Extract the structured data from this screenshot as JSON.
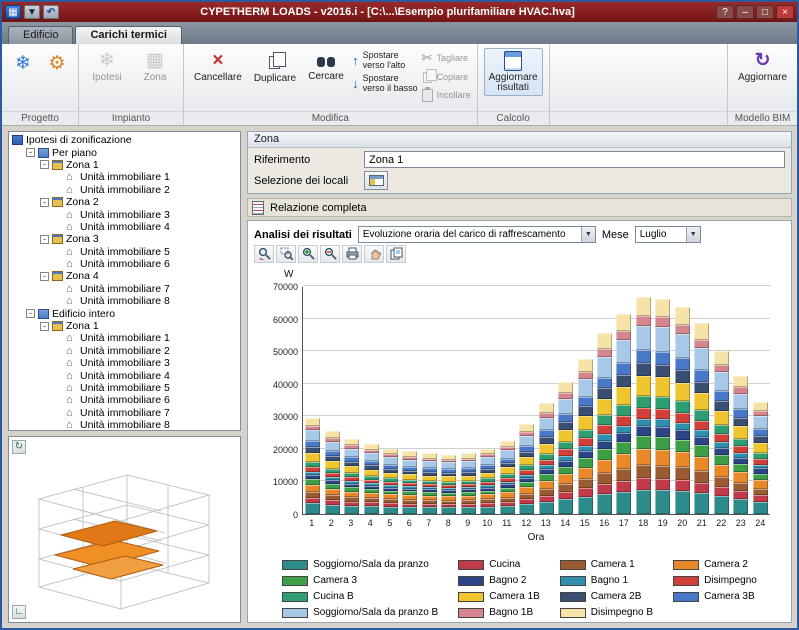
{
  "window": {
    "title": "CYPETHERM LOADS  -  v2016.i - [C:\\...\\Esempio plurifamiliare HVAC.hva]",
    "help": "?",
    "minimize": "–",
    "maximize": "□",
    "close": "×"
  },
  "tabs": {
    "edificio": "Edificio",
    "carichi": "Carichi termici"
  },
  "ribbon": {
    "progetto_label": "Progetto",
    "impianto_label": "Impianto",
    "ipotesi": "Ipotesi",
    "zona": "Zona",
    "modifica_label": "Modifica",
    "cancellare": "Cancellare",
    "duplicare": "Duplicare",
    "cercare": "Cercare",
    "spostare_su": "Spostare\nverso l'alto",
    "spostare_giu": "Spostare\nverso il basso",
    "tagliare": "Tagliare",
    "copiare": "Copiare",
    "incollare": "Incollare",
    "calcolo_label": "Calcolo",
    "aggiornare_risultati": "Aggiornare\nrisultati",
    "bim_label": "Modello BIM",
    "aggiornare": "Aggiornare"
  },
  "tree": {
    "items": [
      {
        "label": "Ipotesi di zonificazione",
        "level": 0,
        "expand": false,
        "icon": "root"
      },
      {
        "label": "Per piano",
        "level": 1,
        "expand": true,
        "icon": "branch"
      },
      {
        "label": "Zona 1",
        "level": 2,
        "expand": true,
        "icon": "zone"
      },
      {
        "label": "Unità immobiliare 1",
        "level": 3,
        "expand": false,
        "icon": "unit"
      },
      {
        "label": "Unità immobiliare 2",
        "level": 3,
        "expand": false,
        "icon": "unit"
      },
      {
        "label": "Zona 2",
        "level": 2,
        "expand": true,
        "icon": "zone"
      },
      {
        "label": "Unità immobiliare 3",
        "level": 3,
        "expand": false,
        "icon": "unit"
      },
      {
        "label": "Unità immobiliare 4",
        "level": 3,
        "expand": false,
        "icon": "unit"
      },
      {
        "label": "Zona 3",
        "level": 2,
        "expand": true,
        "icon": "zone"
      },
      {
        "label": "Unità immobiliare 5",
        "level": 3,
        "expand": false,
        "icon": "unit"
      },
      {
        "label": "Unità immobiliare 6",
        "level": 3,
        "expand": false,
        "icon": "unit"
      },
      {
        "label": "Zona 4",
        "level": 2,
        "expand": true,
        "icon": "zone"
      },
      {
        "label": "Unità immobiliare 7",
        "level": 3,
        "expand": false,
        "icon": "unit"
      },
      {
        "label": "Unità immobiliare 8",
        "level": 3,
        "expand": false,
        "icon": "unit"
      },
      {
        "label": "Edificio intero",
        "level": 1,
        "expand": true,
        "icon": "branch"
      },
      {
        "label": "Zona 1",
        "level": 2,
        "expand": true,
        "icon": "zone"
      },
      {
        "label": "Unità immobiliare 1",
        "level": 3,
        "expand": false,
        "icon": "unit"
      },
      {
        "label": "Unità immobiliare 2",
        "level": 3,
        "expand": false,
        "icon": "unit"
      },
      {
        "label": "Unità immobiliare 3",
        "level": 3,
        "expand": false,
        "icon": "unit"
      },
      {
        "label": "Unità immobiliare 4",
        "level": 3,
        "expand": false,
        "icon": "unit"
      },
      {
        "label": "Unità immobiliare 5",
        "level": 3,
        "expand": false,
        "icon": "unit"
      },
      {
        "label": "Unità immobiliare 6",
        "level": 3,
        "expand": false,
        "icon": "unit"
      },
      {
        "label": "Unità immobiliare 7",
        "level": 3,
        "expand": false,
        "icon": "unit"
      },
      {
        "label": "Unità immobiliare 8",
        "level": 3,
        "expand": false,
        "icon": "unit"
      }
    ]
  },
  "zone_panel": {
    "header": "Zona",
    "riferimento_label": "Riferimento",
    "riferimento_value": "Zona 1",
    "selezione_label": "Selezione dei locali"
  },
  "report": {
    "label": "Relazione completa"
  },
  "results": {
    "analisi_label": "Analisi dei risultati",
    "analisi_value": "Evoluzione oraria del carico di raffrescamento",
    "mese_label": "Mese",
    "mese_value": "Luglio"
  },
  "chart_data": {
    "type": "bar",
    "stacked": true,
    "title": "",
    "ylabel": "W",
    "xlabel": "Ora",
    "ylim": [
      0,
      70000
    ],
    "ytick_step": 10000,
    "grid": true,
    "legend_position": "bottom",
    "x": [
      1,
      2,
      3,
      4,
      5,
      6,
      7,
      8,
      9,
      10,
      11,
      12,
      13,
      14,
      15,
      16,
      17,
      18,
      19,
      20,
      21,
      22,
      23,
      24
    ],
    "totals": [
      29500,
      25500,
      23000,
      21500,
      20000,
      19200,
      18600,
      18200,
      18600,
      20000,
      22500,
      27500,
      34000,
      40500,
      47500,
      55500,
      61500,
      66500,
      66000,
      63500,
      58500,
      50000,
      42500,
      34500
    ],
    "series": [
      {
        "name": "Soggiorno/Sala da pranzo",
        "color": "#2E8B8B",
        "fraction": 0.11
      },
      {
        "name": "Cucina",
        "color": "#C03A4A",
        "fraction": 0.055
      },
      {
        "name": "Camera 1",
        "color": "#9A5B32",
        "fraction": 0.06
      },
      {
        "name": "Camera 2",
        "color": "#E8882B",
        "fraction": 0.075
      },
      {
        "name": "Camera 3",
        "color": "#3E9E46",
        "fraction": 0.06
      },
      {
        "name": "Bagno 2",
        "color": "#2C4587",
        "fraction": 0.045
      },
      {
        "name": "Bagno 1",
        "color": "#2F8FAF",
        "fraction": 0.035
      },
      {
        "name": "Disimpegno",
        "color": "#D04038",
        "fraction": 0.05
      },
      {
        "name": "Cucina B",
        "color": "#2E9E70",
        "fraction": 0.055
      },
      {
        "name": "Camera 1B",
        "color": "#EEC52F",
        "fraction": 0.09
      },
      {
        "name": "Camera 2B",
        "color": "#3A4E72",
        "fraction": 0.06
      },
      {
        "name": "Camera 3B",
        "color": "#4A78C8",
        "fraction": 0.06
      },
      {
        "name": "Soggiorno/Sala da pranzo B",
        "color": "#A8C8E8",
        "fraction": 0.115
      },
      {
        "name": "Bagno 1B",
        "color": "#D4858E",
        "fraction": 0.045
      },
      {
        "name": "Disimpegno B",
        "color": "#F6E3A8",
        "fraction": 0.085
      }
    ]
  }
}
